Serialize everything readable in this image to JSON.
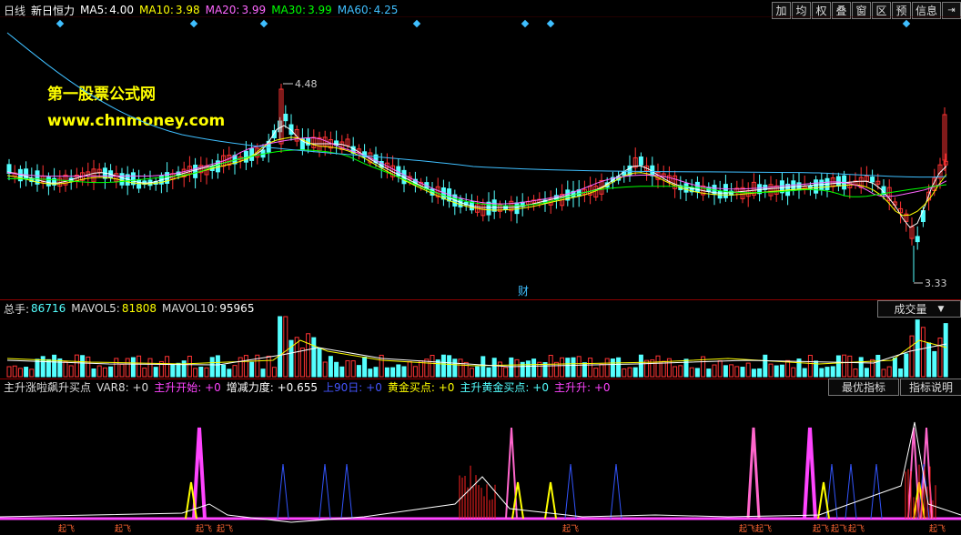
{
  "header": {
    "period": "日线",
    "stock_name": "新日恒力",
    "ma5_label": "MA5:",
    "ma5_value": "4.00",
    "ma5_color": "#ffffff",
    "ma10_label": "MA10:",
    "ma10_value": "3.98",
    "ma10_color": "#ffff00",
    "ma20_label": "MA20:",
    "ma20_value": "3.99",
    "ma20_color": "#ff66ff",
    "ma30_label": "MA30:",
    "ma30_value": "3.99",
    "ma30_color": "#00ff00",
    "ma60_label": "MA60:",
    "ma60_value": "4.25",
    "ma60_color": "#3fbfff"
  },
  "toolbar": {
    "buttons": [
      "加",
      "均",
      "权",
      "叠",
      "窗",
      "区",
      "预",
      "信息"
    ],
    "exit_icon": "exit-arrow-icon"
  },
  "watermark": {
    "line1": "第一股票公式网",
    "line2": "www.chnmoney.com"
  },
  "price_chart": {
    "high_label": "4.48",
    "low_label": "3.33",
    "finance_marker": "财",
    "up_color": "#ff3333",
    "down_color": "#54ffff"
  },
  "volume_panel": {
    "label_total": "总手:",
    "total_value": "86716",
    "mavol5_label": "MAVOL5:",
    "mavol5_value": "81808",
    "mavol10_label": "MAVOL10:",
    "mavol10_value": "95965",
    "dropdown_label": "成交量"
  },
  "indicator_panel": {
    "name": "主升涨啦飙升买点",
    "var8": "VAR8: +0",
    "zhusheng_kaishi": "主升开始: +0",
    "zengjian_lidu": "增减力度: +0.655",
    "shang90": "上90日: +0",
    "huangjin": "黄金买点: +0",
    "zhusheng_huangjin": "主升黄金买点: +0",
    "zhushengsheng": "主升升: +0",
    "btn_best": "最优指标",
    "btn_explain": "指标说明",
    "marker_text": "起飞"
  }
}
